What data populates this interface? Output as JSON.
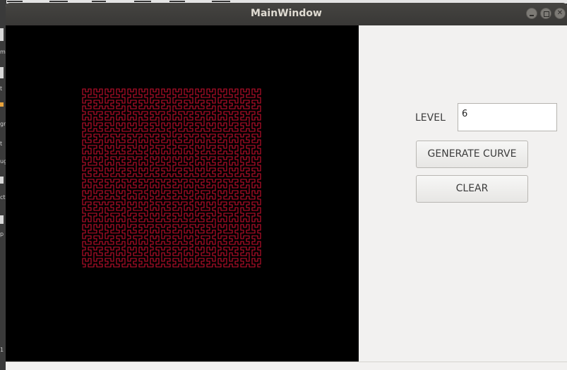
{
  "window": {
    "title": "MainWindow"
  },
  "background_app": {
    "sidebar_fragments": [
      "m",
      "t",
      "gn",
      "t",
      "ug",
      "ct",
      "p",
      "1"
    ]
  },
  "controls": {
    "level_label": "LEVEL",
    "level_value": "6",
    "generate_label": "GENERATE CURVE",
    "clear_label": "CLEAR"
  },
  "curve": {
    "type": "hilbert",
    "level": 6,
    "color": "#c8102e",
    "background": "#000000"
  },
  "colors": {
    "titlebar": "#3f3e3b",
    "panel": "#f2f1f0",
    "canvas": "#000000"
  }
}
